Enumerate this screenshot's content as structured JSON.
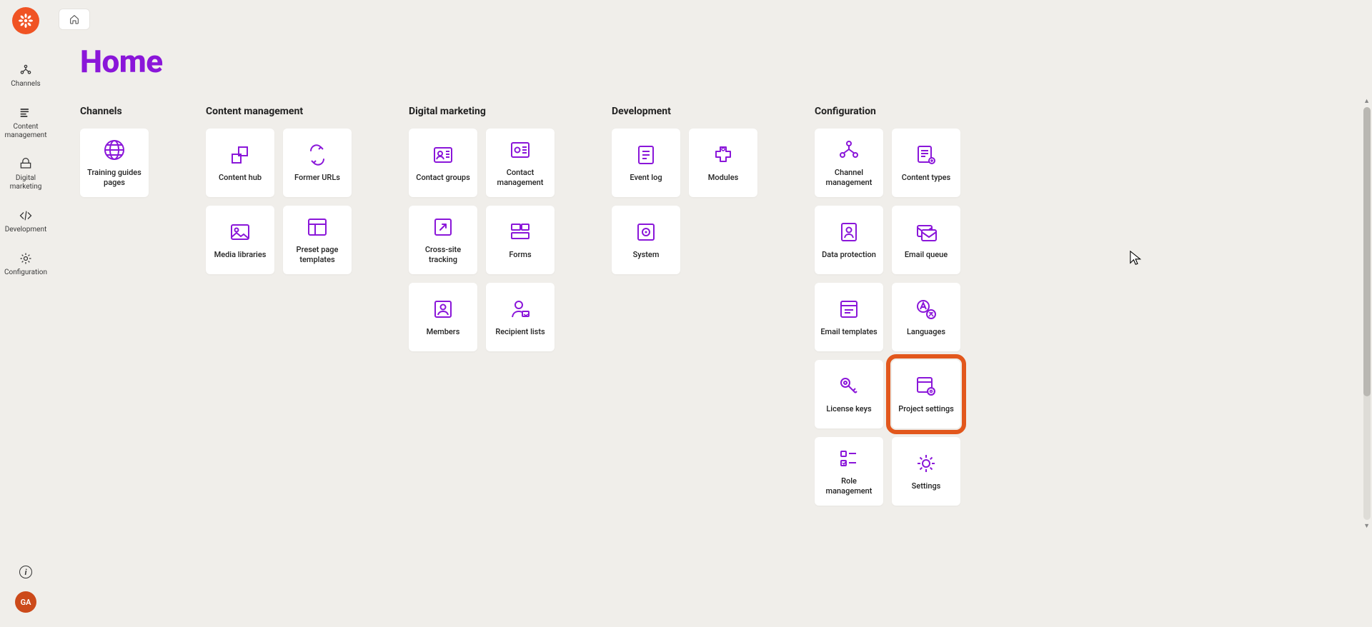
{
  "page_title": "Home",
  "avatar_initials": "GA",
  "sidebar": [
    {
      "icon": "channels",
      "label": "Channels"
    },
    {
      "icon": "content-mgmt",
      "label": "Content management"
    },
    {
      "icon": "digital-mkt",
      "label": "Digital marketing"
    },
    {
      "icon": "development",
      "label": "Development"
    },
    {
      "icon": "configuration",
      "label": "Configuration"
    }
  ],
  "categories": [
    {
      "title": "Channels",
      "single": true,
      "tiles": [
        {
          "icon": "globe",
          "label": "Training guides pages"
        }
      ]
    },
    {
      "title": "Content management",
      "tiles": [
        {
          "icon": "content-hub",
          "label": "Content hub"
        },
        {
          "icon": "former-urls",
          "label": "Former URLs"
        },
        {
          "icon": "media",
          "label": "Media libraries"
        },
        {
          "icon": "preset-templates",
          "label": "Preset page templates"
        }
      ]
    },
    {
      "title": "Digital marketing",
      "tiles": [
        {
          "icon": "contact-groups",
          "label": "Contact groups"
        },
        {
          "icon": "contact-mgmt",
          "label": "Contact management"
        },
        {
          "icon": "cross-site",
          "label": "Cross-site tracking"
        },
        {
          "icon": "forms",
          "label": "Forms"
        },
        {
          "icon": "members",
          "label": "Members"
        },
        {
          "icon": "recipient",
          "label": "Recipient lists"
        }
      ]
    },
    {
      "title": "Development",
      "tiles": [
        {
          "icon": "event-log",
          "label": "Event log"
        },
        {
          "icon": "modules",
          "label": "Modules"
        },
        {
          "icon": "system",
          "label": "System"
        }
      ]
    },
    {
      "title": "Configuration",
      "tiles": [
        {
          "icon": "channel-mgmt",
          "label": "Channel management"
        },
        {
          "icon": "content-types",
          "label": "Content types"
        },
        {
          "icon": "data-protection",
          "label": "Data protection"
        },
        {
          "icon": "email-queue",
          "label": "Email queue"
        },
        {
          "icon": "email-templates",
          "label": "Email templates"
        },
        {
          "icon": "languages",
          "label": "Languages"
        },
        {
          "icon": "license-keys",
          "label": "License keys"
        },
        {
          "icon": "project-settings",
          "label": "Project settings",
          "highlighted": true
        },
        {
          "icon": "role-mgmt",
          "label": "Role management"
        },
        {
          "icon": "settings",
          "label": "Settings"
        }
      ]
    }
  ]
}
